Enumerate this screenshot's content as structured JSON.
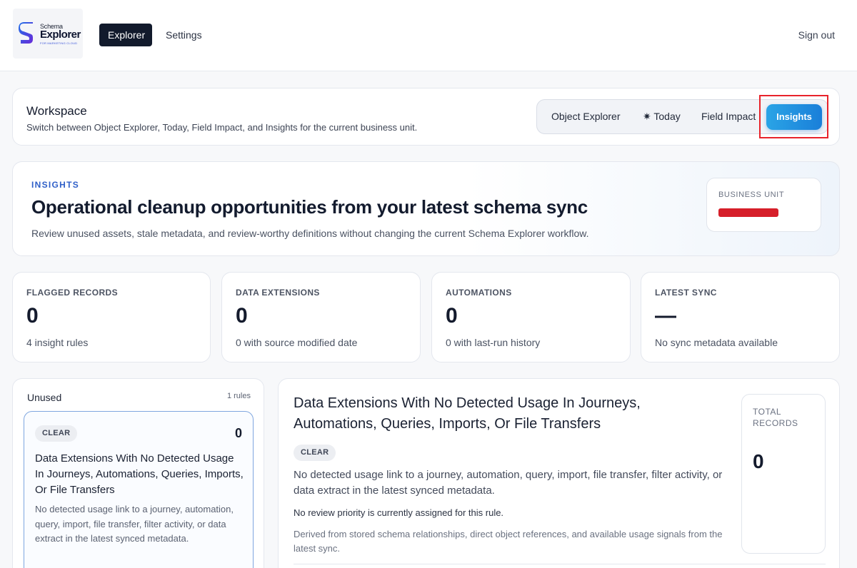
{
  "brand": {
    "name_small": "Schema",
    "name_big": "Explorer",
    "tagline": "FOR MARKETING CLOUD"
  },
  "nav": {
    "explorer": "Explorer",
    "settings": "Settings",
    "sign_out": "Sign out"
  },
  "workspace": {
    "title": "Workspace",
    "subtitle": "Switch between Object Explorer, Today, Field Impact, and Insights for the current business unit.",
    "tabs": {
      "object_explorer": "Object Explorer",
      "today": "✷ Today",
      "field_impact": "Field Impact",
      "insights": "Insights"
    },
    "active_tab": "Insights"
  },
  "hero": {
    "eyebrow": "INSIGHTS",
    "title": "Operational cleanup opportunities from your latest schema sync",
    "subtitle": "Review unused assets, stale metadata, and review-worthy definitions without changing the current Schema Explorer workflow.",
    "business_unit_label": "BUSINESS UNIT",
    "business_unit_value": "[redacted]"
  },
  "stats": [
    {
      "label": "FLAGGED RECORDS",
      "value": "0",
      "sub": "4 insight rules"
    },
    {
      "label": "DATA EXTENSIONS",
      "value": "0",
      "sub": "0 with source modified date"
    },
    {
      "label": "AUTOMATIONS",
      "value": "0",
      "sub": "0 with last-run history"
    },
    {
      "label": "LATEST SYNC",
      "value": "—",
      "sub": "No sync metadata available"
    }
  ],
  "rules": {
    "group_title": "Unused",
    "group_count": "1 rules",
    "items": [
      {
        "badge": "CLEAR",
        "count": "0",
        "title": "Data Extensions With No Detected Usage In Journeys, Automations, Queries, Imports, Or File Transfers",
        "description": "No detected usage link to a journey, automation, query, import, file transfer, filter activity, or data extract in the latest synced metadata."
      }
    ]
  },
  "detail": {
    "title": "Data Extensions With No Detected Usage In Journeys, Automations, Queries, Imports, Or File Transfers",
    "badge": "CLEAR",
    "description": "No detected usage link to a journey, automation, query, import, file transfer, filter activity, or data extract in the latest synced metadata.",
    "priority": "No review priority is currently assigned for this rule.",
    "derived": "Derived from stored schema relationships, direct object references, and available usage signals from the latest sync.",
    "total_label": "TOTAL RECORDS",
    "total_value": "0"
  },
  "colors": {
    "primary_dark": "#121a2c",
    "accent_blue": "#1a7fd9",
    "highlight_red": "#e8232b",
    "eyebrow_blue": "#2f5fc8"
  }
}
